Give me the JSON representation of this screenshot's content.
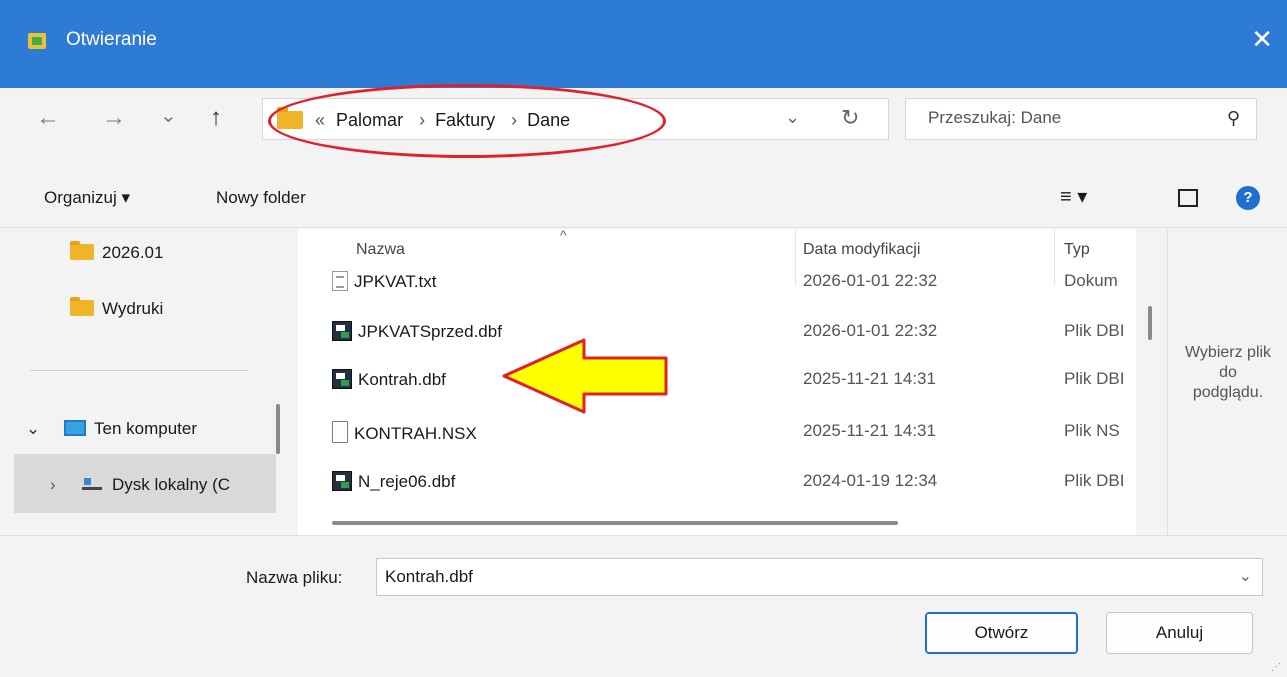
{
  "window": {
    "title": "Otwieranie",
    "close_glyph": "✕"
  },
  "nav": {
    "back_glyph": "←",
    "forward_glyph": "→",
    "recent_glyph": "⌄",
    "up_glyph": "↑",
    "breadcrumb_overflow": "«",
    "breadcrumbs": [
      "Palomar",
      "Faktury",
      "Dane"
    ],
    "separator": "›",
    "dropdown_glyph": "⌄",
    "refresh_glyph": "↻",
    "search_placeholder": "Przeszukaj: Dane",
    "search_glyph": "⚲"
  },
  "toolbar": {
    "organize_label": "Organizuj ▾",
    "new_folder_label": "Nowy folder",
    "view_glyph": "≡ ▾",
    "help_glyph": "?"
  },
  "sidebar": {
    "items": [
      {
        "label": "2026.01",
        "icon": "folder-icon"
      },
      {
        "label": "Wydruki",
        "icon": "folder-icon"
      },
      {
        "label": "Ten komputer",
        "icon": "computer-icon",
        "expander": "⌄"
      },
      {
        "label": "Dysk lokalny (C",
        "icon": "drive-icon",
        "expander": "›"
      }
    ]
  },
  "columns": {
    "name": "Nazwa",
    "date": "Data modyfikacji",
    "type": "Typ",
    "sort_glyph": "^"
  },
  "files": [
    {
      "name": "JPKVAT.txt",
      "date": "2026-01-01 22:32",
      "type": "Dokum",
      "icon": "text-file-icon"
    },
    {
      "name": "JPKVATSprzed.dbf",
      "date": "2026-01-01 22:32",
      "type": "Plik DBI",
      "icon": "dbf-file-icon"
    },
    {
      "name": "Kontrah.dbf",
      "date": "2025-11-21 14:31",
      "type": "Plik DBI",
      "icon": "dbf-file-icon"
    },
    {
      "name": "KONTRAH.NSX",
      "date": "2025-11-21 14:31",
      "type": "Plik NS",
      "icon": "generic-file-icon"
    },
    {
      "name": "N_reje06.dbf",
      "date": "2024-01-19 12:34",
      "type": "Plik DBI",
      "icon": "dbf-file-icon"
    }
  ],
  "preview": {
    "text_line1": "Wybierz plik",
    "text_line2": "do",
    "text_line3": "podglądu."
  },
  "footer": {
    "filename_label": "Nazwa pliku:",
    "filename_value": "Kontrah.dbf",
    "open_label": "Otwórz",
    "cancel_label": "Anuluj"
  },
  "annotations": {
    "oval_color": "#e0202a",
    "arrow_fill": "#ffff00",
    "arrow_stroke": "#e0202a"
  }
}
